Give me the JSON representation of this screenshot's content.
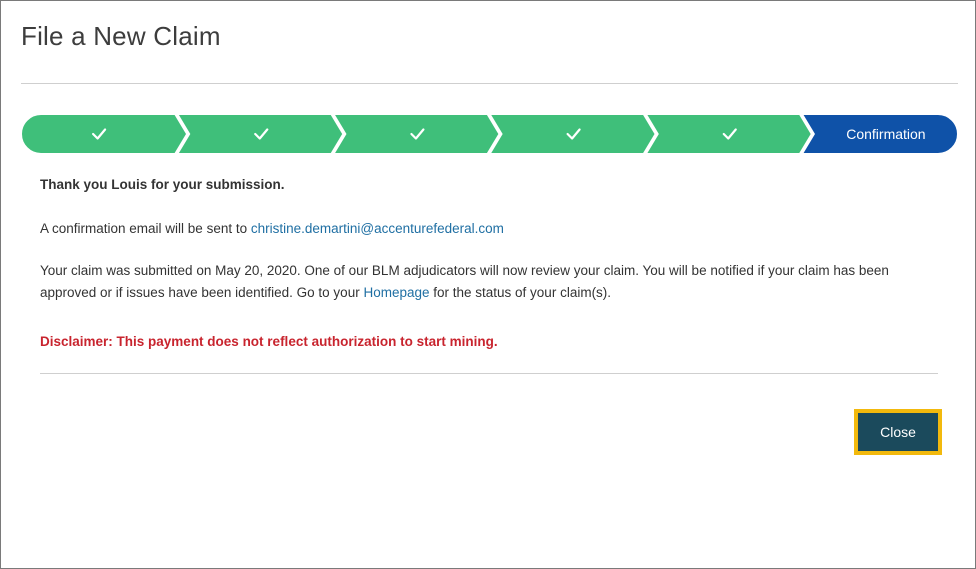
{
  "dialog": {
    "title": "File a New Claim"
  },
  "stepper": {
    "colors": {
      "completed": "#3fbf7a",
      "current": "#0f52a8"
    },
    "steps": [
      {
        "state": "completed",
        "icon": "checkmark-icon",
        "label": ""
      },
      {
        "state": "completed",
        "icon": "checkmark-icon",
        "label": ""
      },
      {
        "state": "completed",
        "icon": "checkmark-icon",
        "label": ""
      },
      {
        "state": "completed",
        "icon": "checkmark-icon",
        "label": ""
      },
      {
        "state": "completed",
        "icon": "checkmark-icon",
        "label": ""
      },
      {
        "state": "current",
        "icon": "",
        "label": "Confirmation"
      }
    ]
  },
  "message": {
    "thanks": "Thank you Louis for your submission.",
    "email_prefix": "A confirmation email will be sent to ",
    "email": "christine.demartini@accenturefederal.com",
    "review_text": "Your claim was submitted on May 20, 2020. One of our BLM adjudicators will now review your claim. You will be notified if your claim has been approved or if issues have been identified. Go to your ",
    "homepage_link": "Homepage",
    "review_suffix": " for the status of your claim(s).",
    "disclaimer": "Disclaimer: This payment does not reflect authorization to start mining.",
    "disclaimer_color": "#c8242e"
  },
  "actions": {
    "close_label": "Close",
    "highlight_color": "#f2b90d",
    "button_color": "#1b4a5c"
  }
}
